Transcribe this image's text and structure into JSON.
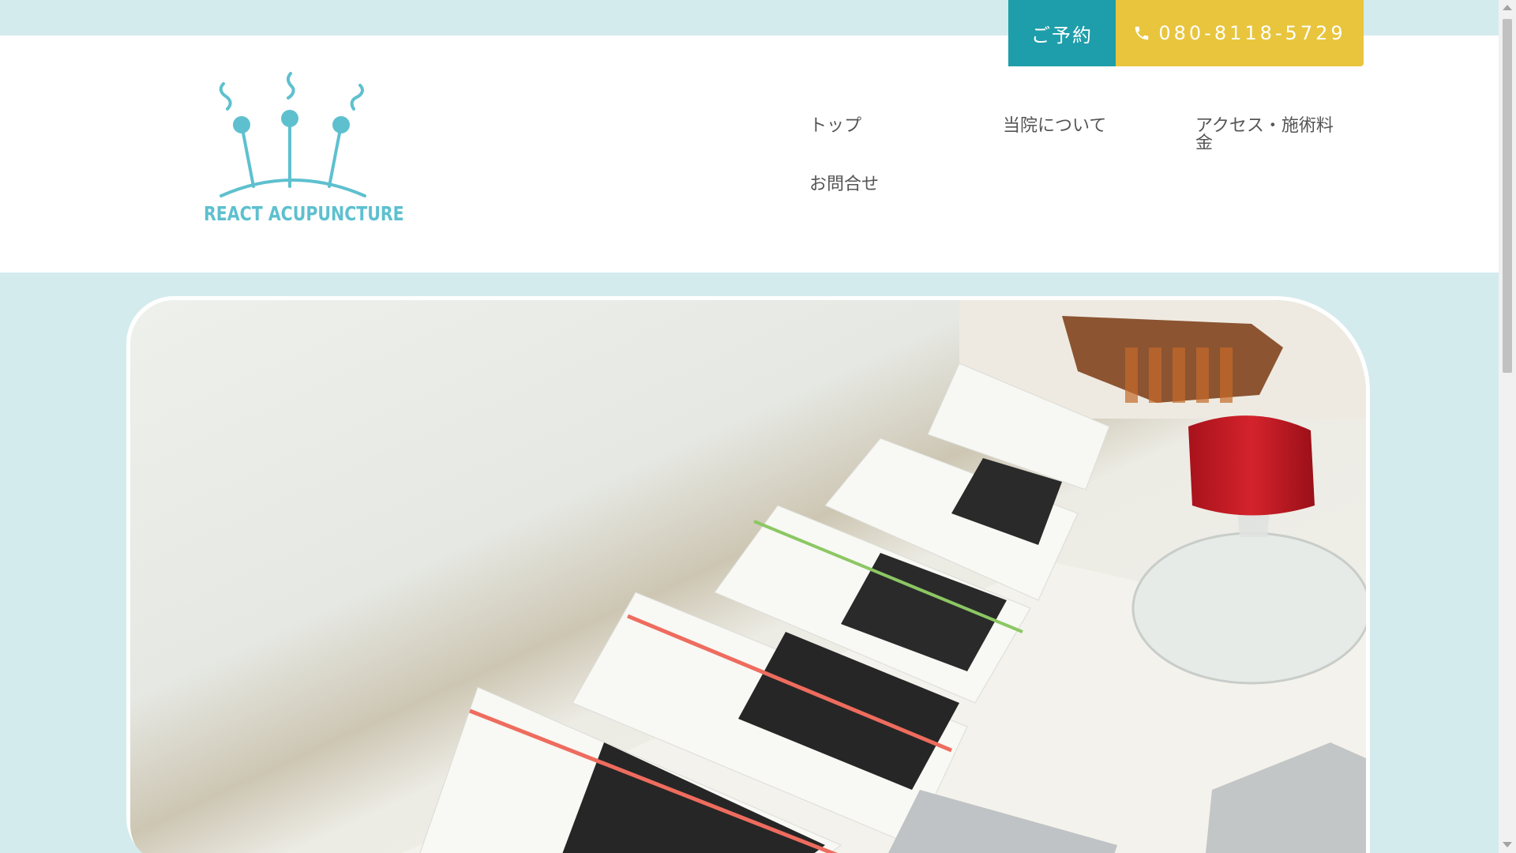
{
  "header": {
    "logo_text": "REACT ACUPUNCTURE",
    "reserve_label": "ご予約",
    "phone_label": "080-8118-5729",
    "accent_color": "#1e9eaa",
    "phone_button_color": "#e8c53d",
    "logo_color": "#5ec0cf"
  },
  "nav": {
    "items": [
      {
        "label": "トップ"
      },
      {
        "label": "当院について"
      },
      {
        "label": "アクセス・施術料"
      },
      {
        "label": "金"
      },
      {
        "label": "お問合せ"
      }
    ]
  },
  "hero": {
    "image_subject": "acupuncture-needle-boxes-photo"
  },
  "icons": {
    "phone": "phone-icon",
    "logo": "acupuncture-needles-logo-icon"
  }
}
